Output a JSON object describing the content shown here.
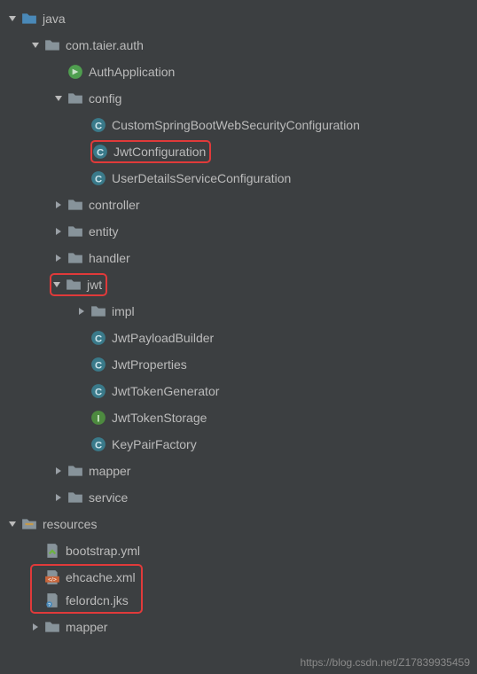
{
  "tree": {
    "java": "java",
    "com_taier_auth": "com.taier.auth",
    "auth_application": "AuthApplication",
    "config": "config",
    "custom_spring": "CustomSpringBootWebSecurityConfiguration",
    "jwt_configuration": "JwtConfiguration",
    "user_details": "UserDetailsServiceConfiguration",
    "controller": "controller",
    "entity": "entity",
    "handler": "handler",
    "jwt": "jwt",
    "impl": "impl",
    "jwt_payload_builder": "JwtPayloadBuilder",
    "jwt_properties": "JwtProperties",
    "jwt_token_generator": "JwtTokenGenerator",
    "jwt_token_storage": "JwtTokenStorage",
    "key_pair_factory": "KeyPairFactory",
    "mapper": "mapper",
    "service": "service",
    "resources": "resources",
    "bootstrap_yml": "bootstrap.yml",
    "ehcache_xml": "ehcache.xml",
    "felordcn_jks": "felordcn.jks",
    "mapper2": "mapper"
  },
  "watermark": "https://blog.csdn.net/Z17839935459"
}
